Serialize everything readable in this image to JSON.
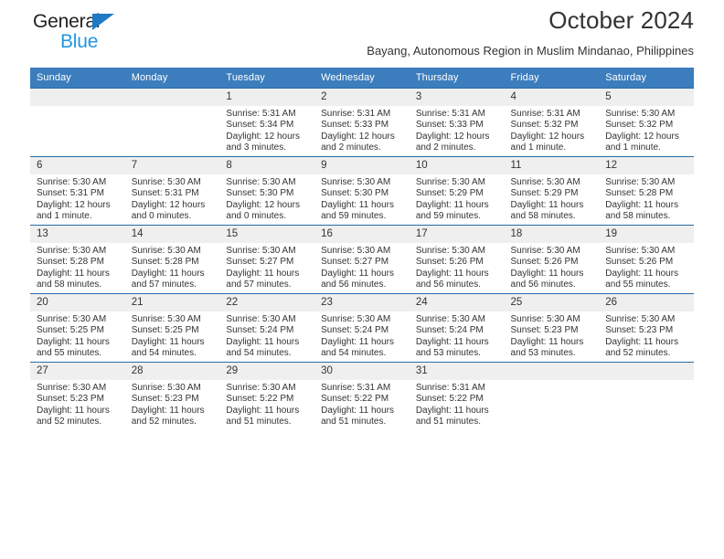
{
  "brand": {
    "name_line1": "General",
    "name_line2": "Blue",
    "triangle_icon": "triangle-icon",
    "color_dark": "#231f20",
    "color_blue": "#2196e3"
  },
  "header": {
    "title": "October 2024",
    "subtitle": "Bayang, Autonomous Region in Muslim Mindanao, Philippines"
  },
  "theme": {
    "header_row_bg": "#3b7dbd",
    "header_row_text": "#ffffff",
    "row_border": "#2a6aa8",
    "daynum_bg": "#efefef",
    "body_text": "#333333"
  },
  "weekday_headers": [
    "Sunday",
    "Monday",
    "Tuesday",
    "Wednesday",
    "Thursday",
    "Friday",
    "Saturday"
  ],
  "labels": {
    "sunrise_prefix": "Sunrise:",
    "sunset_prefix": "Sunset:",
    "daylight_prefix": "Daylight:"
  },
  "weeks": [
    [
      {
        "day": "",
        "sunrise": "",
        "sunset": "",
        "daylight_line1": "",
        "daylight_line2": ""
      },
      {
        "day": "",
        "sunrise": "",
        "sunset": "",
        "daylight_line1": "",
        "daylight_line2": ""
      },
      {
        "day": "1",
        "sunrise": "Sunrise: 5:31 AM",
        "sunset": "Sunset: 5:34 PM",
        "daylight_line1": "Daylight: 12 hours",
        "daylight_line2": "and 3 minutes."
      },
      {
        "day": "2",
        "sunrise": "Sunrise: 5:31 AM",
        "sunset": "Sunset: 5:33 PM",
        "daylight_line1": "Daylight: 12 hours",
        "daylight_line2": "and 2 minutes."
      },
      {
        "day": "3",
        "sunrise": "Sunrise: 5:31 AM",
        "sunset": "Sunset: 5:33 PM",
        "daylight_line1": "Daylight: 12 hours",
        "daylight_line2": "and 2 minutes."
      },
      {
        "day": "4",
        "sunrise": "Sunrise: 5:31 AM",
        "sunset": "Sunset: 5:32 PM",
        "daylight_line1": "Daylight: 12 hours",
        "daylight_line2": "and 1 minute."
      },
      {
        "day": "5",
        "sunrise": "Sunrise: 5:30 AM",
        "sunset": "Sunset: 5:32 PM",
        "daylight_line1": "Daylight: 12 hours",
        "daylight_line2": "and 1 minute."
      }
    ],
    [
      {
        "day": "6",
        "sunrise": "Sunrise: 5:30 AM",
        "sunset": "Sunset: 5:31 PM",
        "daylight_line1": "Daylight: 12 hours",
        "daylight_line2": "and 1 minute."
      },
      {
        "day": "7",
        "sunrise": "Sunrise: 5:30 AM",
        "sunset": "Sunset: 5:31 PM",
        "daylight_line1": "Daylight: 12 hours",
        "daylight_line2": "and 0 minutes."
      },
      {
        "day": "8",
        "sunrise": "Sunrise: 5:30 AM",
        "sunset": "Sunset: 5:30 PM",
        "daylight_line1": "Daylight: 12 hours",
        "daylight_line2": "and 0 minutes."
      },
      {
        "day": "9",
        "sunrise": "Sunrise: 5:30 AM",
        "sunset": "Sunset: 5:30 PM",
        "daylight_line1": "Daylight: 11 hours",
        "daylight_line2": "and 59 minutes."
      },
      {
        "day": "10",
        "sunrise": "Sunrise: 5:30 AM",
        "sunset": "Sunset: 5:29 PM",
        "daylight_line1": "Daylight: 11 hours",
        "daylight_line2": "and 59 minutes."
      },
      {
        "day": "11",
        "sunrise": "Sunrise: 5:30 AM",
        "sunset": "Sunset: 5:29 PM",
        "daylight_line1": "Daylight: 11 hours",
        "daylight_line2": "and 58 minutes."
      },
      {
        "day": "12",
        "sunrise": "Sunrise: 5:30 AM",
        "sunset": "Sunset: 5:28 PM",
        "daylight_line1": "Daylight: 11 hours",
        "daylight_line2": "and 58 minutes."
      }
    ],
    [
      {
        "day": "13",
        "sunrise": "Sunrise: 5:30 AM",
        "sunset": "Sunset: 5:28 PM",
        "daylight_line1": "Daylight: 11 hours",
        "daylight_line2": "and 58 minutes."
      },
      {
        "day": "14",
        "sunrise": "Sunrise: 5:30 AM",
        "sunset": "Sunset: 5:28 PM",
        "daylight_line1": "Daylight: 11 hours",
        "daylight_line2": "and 57 minutes."
      },
      {
        "day": "15",
        "sunrise": "Sunrise: 5:30 AM",
        "sunset": "Sunset: 5:27 PM",
        "daylight_line1": "Daylight: 11 hours",
        "daylight_line2": "and 57 minutes."
      },
      {
        "day": "16",
        "sunrise": "Sunrise: 5:30 AM",
        "sunset": "Sunset: 5:27 PM",
        "daylight_line1": "Daylight: 11 hours",
        "daylight_line2": "and 56 minutes."
      },
      {
        "day": "17",
        "sunrise": "Sunrise: 5:30 AM",
        "sunset": "Sunset: 5:26 PM",
        "daylight_line1": "Daylight: 11 hours",
        "daylight_line2": "and 56 minutes."
      },
      {
        "day": "18",
        "sunrise": "Sunrise: 5:30 AM",
        "sunset": "Sunset: 5:26 PM",
        "daylight_line1": "Daylight: 11 hours",
        "daylight_line2": "and 56 minutes."
      },
      {
        "day": "19",
        "sunrise": "Sunrise: 5:30 AM",
        "sunset": "Sunset: 5:26 PM",
        "daylight_line1": "Daylight: 11 hours",
        "daylight_line2": "and 55 minutes."
      }
    ],
    [
      {
        "day": "20",
        "sunrise": "Sunrise: 5:30 AM",
        "sunset": "Sunset: 5:25 PM",
        "daylight_line1": "Daylight: 11 hours",
        "daylight_line2": "and 55 minutes."
      },
      {
        "day": "21",
        "sunrise": "Sunrise: 5:30 AM",
        "sunset": "Sunset: 5:25 PM",
        "daylight_line1": "Daylight: 11 hours",
        "daylight_line2": "and 54 minutes."
      },
      {
        "day": "22",
        "sunrise": "Sunrise: 5:30 AM",
        "sunset": "Sunset: 5:24 PM",
        "daylight_line1": "Daylight: 11 hours",
        "daylight_line2": "and 54 minutes."
      },
      {
        "day": "23",
        "sunrise": "Sunrise: 5:30 AM",
        "sunset": "Sunset: 5:24 PM",
        "daylight_line1": "Daylight: 11 hours",
        "daylight_line2": "and 54 minutes."
      },
      {
        "day": "24",
        "sunrise": "Sunrise: 5:30 AM",
        "sunset": "Sunset: 5:24 PM",
        "daylight_line1": "Daylight: 11 hours",
        "daylight_line2": "and 53 minutes."
      },
      {
        "day": "25",
        "sunrise": "Sunrise: 5:30 AM",
        "sunset": "Sunset: 5:23 PM",
        "daylight_line1": "Daylight: 11 hours",
        "daylight_line2": "and 53 minutes."
      },
      {
        "day": "26",
        "sunrise": "Sunrise: 5:30 AM",
        "sunset": "Sunset: 5:23 PM",
        "daylight_line1": "Daylight: 11 hours",
        "daylight_line2": "and 52 minutes."
      }
    ],
    [
      {
        "day": "27",
        "sunrise": "Sunrise: 5:30 AM",
        "sunset": "Sunset: 5:23 PM",
        "daylight_line1": "Daylight: 11 hours",
        "daylight_line2": "and 52 minutes."
      },
      {
        "day": "28",
        "sunrise": "Sunrise: 5:30 AM",
        "sunset": "Sunset: 5:23 PM",
        "daylight_line1": "Daylight: 11 hours",
        "daylight_line2": "and 52 minutes."
      },
      {
        "day": "29",
        "sunrise": "Sunrise: 5:30 AM",
        "sunset": "Sunset: 5:22 PM",
        "daylight_line1": "Daylight: 11 hours",
        "daylight_line2": "and 51 minutes."
      },
      {
        "day": "30",
        "sunrise": "Sunrise: 5:31 AM",
        "sunset": "Sunset: 5:22 PM",
        "daylight_line1": "Daylight: 11 hours",
        "daylight_line2": "and 51 minutes."
      },
      {
        "day": "31",
        "sunrise": "Sunrise: 5:31 AM",
        "sunset": "Sunset: 5:22 PM",
        "daylight_line1": "Daylight: 11 hours",
        "daylight_line2": "and 51 minutes."
      },
      {
        "day": "",
        "sunrise": "",
        "sunset": "",
        "daylight_line1": "",
        "daylight_line2": ""
      },
      {
        "day": "",
        "sunrise": "",
        "sunset": "",
        "daylight_line1": "",
        "daylight_line2": ""
      }
    ]
  ]
}
